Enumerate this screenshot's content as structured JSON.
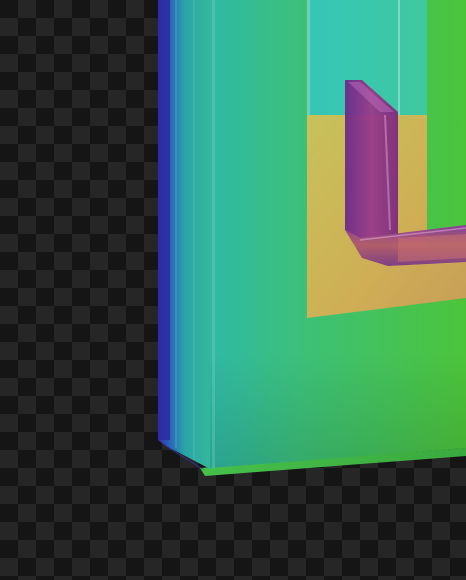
{
  "scene": {
    "background": "transparency-checkerboard",
    "shape": "glass-layered-frame-corner",
    "colors": {
      "checker_dark": "#151515",
      "checker_light": "#262626",
      "green_panel": "#3dbb4a",
      "teal_panel": "#3ccab0",
      "yellow_panel": "#c9b65a",
      "purple_glass": "#8a2f8e",
      "blue_edge": "#2a2a9e"
    }
  }
}
